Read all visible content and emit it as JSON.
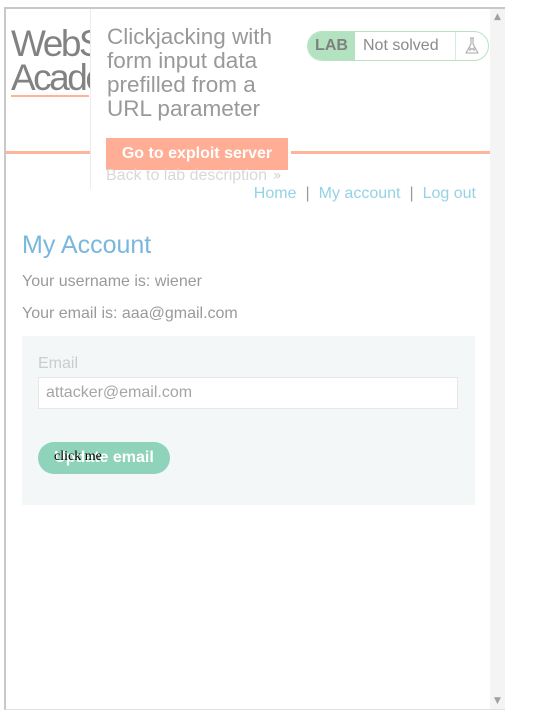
{
  "logo": {
    "line1": "WebS",
    "line2": "Acade"
  },
  "header": {
    "lab_title": "Clickjacking with form input data prefilled from a URL parameter",
    "exploit_button_label": "Go to exploit server",
    "back_link_label": "Back to lab description",
    "back_chevrons": "»",
    "lab_badge": "LAB",
    "lab_status": "Not solved",
    "flask_icon": "flask-icon"
  },
  "nav": {
    "home": "Home",
    "my_account": "My account",
    "logout": "Log out",
    "separator": "|"
  },
  "main": {
    "heading": "My Account",
    "username_line": "Your username is: wiener",
    "email_line": "Your email is: aaa@gmail.com"
  },
  "form": {
    "email_label": "Email",
    "email_value": "attacker@email.com",
    "submit_label": "Update email"
  },
  "decoy": {
    "label": "click me"
  },
  "scrollbar": {
    "up": "▲",
    "down": "▼"
  },
  "colors": {
    "accent_orange": "#ff6633",
    "button_orange": "#ffad94",
    "lab_green": "#b3e2c1",
    "heading_blue": "#79b7dd",
    "nav_link": "#94d3e6",
    "update_button": "#8fd3bb"
  }
}
